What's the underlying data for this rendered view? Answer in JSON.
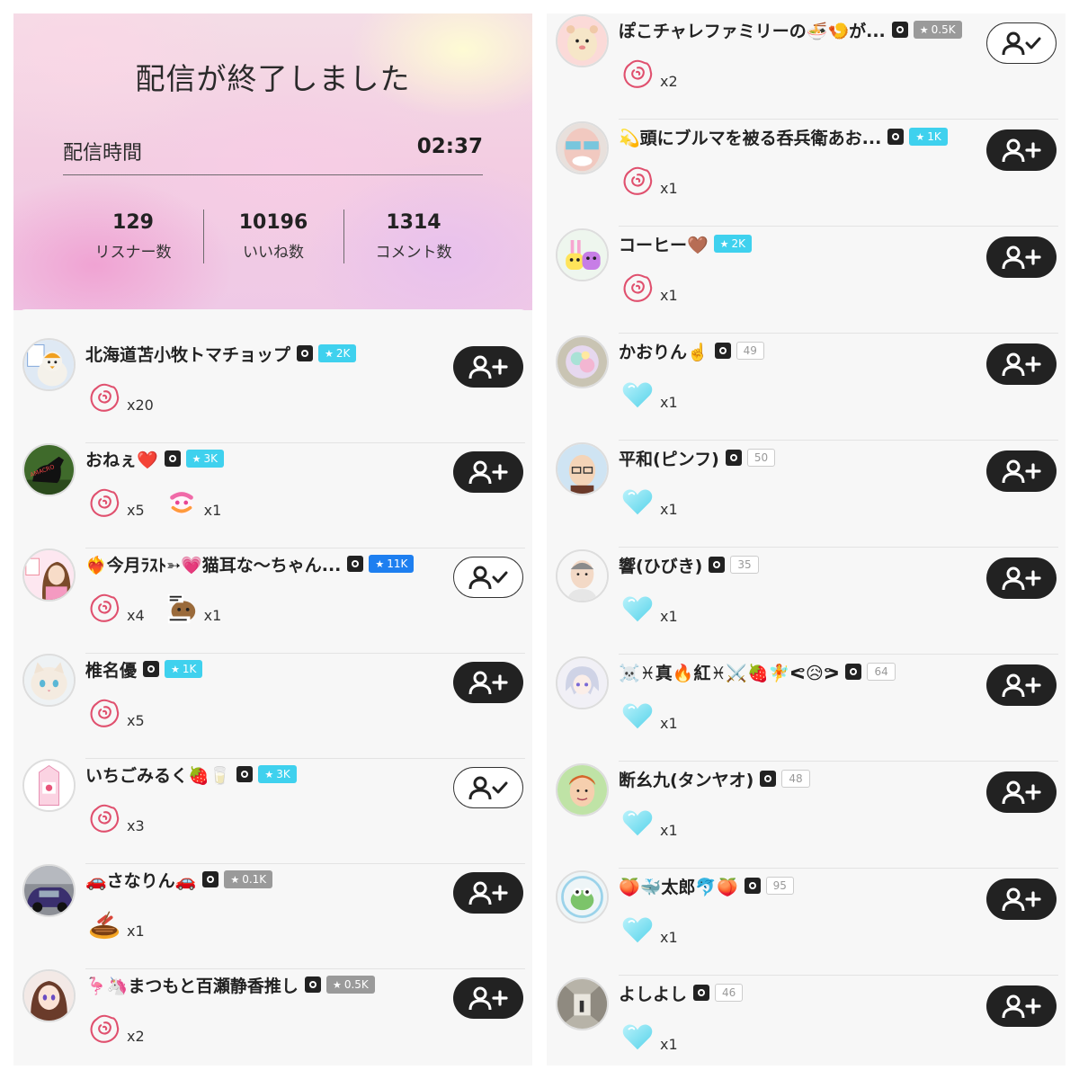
{
  "summary": {
    "title": "配信が終了しました",
    "duration_label": "配信時間",
    "duration_value": "02:37",
    "stats": [
      {
        "value": "129",
        "label": "リスナー数"
      },
      {
        "value": "10196",
        "label": "いいね数"
      },
      {
        "value": "1314",
        "label": "コメント数"
      }
    ]
  },
  "left_users": [
    {
      "name": "北海道苫小牧トマチョップ",
      "gender": "male",
      "level": "2K",
      "level_style": "cyan",
      "gifts": [
        {
          "type": "rose",
          "count": "x20"
        }
      ],
      "followed": false,
      "avatar": "chick"
    },
    {
      "name": "おねぇ❤️",
      "gender": "female",
      "level": "3K",
      "level_style": "cyan",
      "gifts": [
        {
          "type": "rose",
          "count": "x5"
        },
        {
          "type": "sticker-pink",
          "count": "x1"
        }
      ],
      "followed": false,
      "avatar": "horse"
    },
    {
      "name": "❤️‍🔥今月ﾗｽﾄ➳💗猫耳な〜ちゃん...",
      "gender": "female",
      "level": "11K",
      "level_style": "blue",
      "gifts": [
        {
          "type": "rose",
          "count": "x4"
        },
        {
          "type": "sticker-brown",
          "count": "x1"
        }
      ],
      "followed": true,
      "avatar": "girl"
    },
    {
      "name": "椎名優",
      "gender": "male",
      "level": "1K",
      "level_style": "cyan",
      "gifts": [
        {
          "type": "rose",
          "count": "x5"
        }
      ],
      "followed": false,
      "avatar": "cat"
    },
    {
      "name": "いちごみるく🍓🥛",
      "gender": "female",
      "level": "3K",
      "level_style": "cyan",
      "gifts": [
        {
          "type": "rose",
          "count": "x3"
        }
      ],
      "followed": true,
      "avatar": "milk"
    },
    {
      "name": "🚗さなりん🚗",
      "gender": "female",
      "level": "0.1K",
      "level_style": "gray",
      "gifts": [
        {
          "type": "bbq",
          "count": "x1"
        }
      ],
      "followed": false,
      "avatar": "car"
    },
    {
      "name": "🦩🦄まつもと百瀬静香推し",
      "gender": "male",
      "level": "0.5K",
      "level_style": "gray",
      "gifts": [
        {
          "type": "rose",
          "count": "x2"
        }
      ],
      "followed": false,
      "avatar": "anime"
    }
  ],
  "right_users": [
    {
      "name": "ぽこチャレファミリーの🍜🍤が...",
      "gender": "male",
      "level": "0.5K",
      "level_style": "gray",
      "gifts": [
        {
          "type": "rose",
          "count": "x2"
        }
      ],
      "followed": true,
      "avatar": "hamster"
    },
    {
      "name": "💫頭にブルマを被る呑兵衛あお...",
      "gender": "male",
      "level": "1K",
      "level_style": "cyan",
      "gifts": [
        {
          "type": "rose",
          "count": "x1"
        }
      ],
      "followed": false,
      "avatar": "face"
    },
    {
      "name": "コーヒー🤎",
      "gender": "none",
      "level": "2K",
      "level_style": "cyan",
      "gifts": [
        {
          "type": "rose",
          "count": "x1"
        }
      ],
      "followed": false,
      "avatar": "bunnies"
    },
    {
      "name": "かおりん☝️",
      "gender": "female",
      "level": "49",
      "level_style": "plain",
      "gifts": [
        {
          "type": "heart",
          "count": "x1"
        }
      ],
      "followed": false,
      "avatar": "crystal"
    },
    {
      "name": "平和(ピンフ)",
      "gender": "male",
      "level": "50",
      "level_style": "plain",
      "gifts": [
        {
          "type": "heart",
          "count": "x1"
        }
      ],
      "followed": false,
      "avatar": "glasses"
    },
    {
      "name": "響(ひびき)",
      "gender": "male",
      "level": "35",
      "level_style": "plain",
      "gifts": [
        {
          "type": "heart",
          "count": "x1"
        }
      ],
      "followed": false,
      "avatar": "man"
    },
    {
      "name": "☠️♓真🔥紅♓⚔️🍓🧚ᕙ😥ᕗ",
      "gender": "male",
      "level": "64",
      "level_style": "plain",
      "gifts": [
        {
          "type": "heart",
          "count": "x1"
        }
      ],
      "followed": false,
      "avatar": "silver"
    },
    {
      "name": "断幺九(タンヤオ)",
      "gender": "male",
      "level": "48",
      "level_style": "plain",
      "gifts": [
        {
          "type": "heart",
          "count": "x1"
        }
      ],
      "followed": false,
      "avatar": "redhair"
    },
    {
      "name": "🍑🐳太郎🐬🍑",
      "gender": "male",
      "level": "95",
      "level_style": "plain",
      "gifts": [
        {
          "type": "heart",
          "count": "x1"
        }
      ],
      "followed": false,
      "avatar": "frog"
    },
    {
      "name": "よしよし",
      "gender": "female",
      "level": "46",
      "level_style": "plain",
      "gifts": [
        {
          "type": "heart",
          "count": "x1"
        }
      ],
      "followed": false,
      "avatar": "hallway"
    }
  ]
}
